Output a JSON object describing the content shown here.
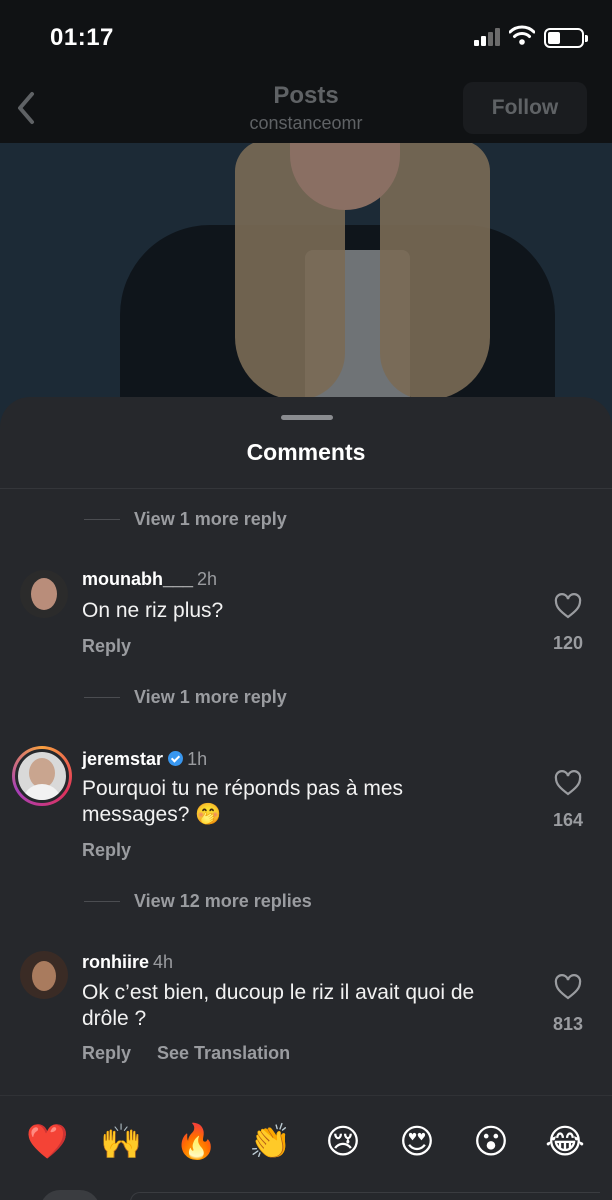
{
  "status_bar": {
    "time": "01:17"
  },
  "header": {
    "title": "Posts",
    "subtitle": "constanceomr",
    "follow_label": "Follow"
  },
  "sheet": {
    "title": "Comments"
  },
  "view_more": [
    {
      "label": "View 1 more reply"
    },
    {
      "label": "View 1 more reply"
    },
    {
      "label": "View 12 more replies"
    }
  ],
  "comments": [
    {
      "username": "mounabh___",
      "ago": "2h",
      "verified": false,
      "text": "On ne riz plus?",
      "likes": "120",
      "actions": [
        "Reply"
      ]
    },
    {
      "username": "jeremstar",
      "ago": "1h",
      "verified": true,
      "text": "Pourquoi tu ne réponds pas à mes messages? 🤭",
      "likes": "164",
      "actions": [
        "Reply"
      ]
    },
    {
      "username": "ronhiire",
      "ago": "4h",
      "verified": false,
      "text": "Ok c’est bien, ducoup le riz il avait quoi de drôle ?",
      "likes": "813",
      "actions": [
        "Reply",
        "See Translation"
      ]
    }
  ],
  "emoji_bar": [
    "❤️",
    "🙌",
    "🔥",
    "👏",
    "😢",
    "😍",
    "😮",
    "😂"
  ],
  "colors": {
    "sheet_bg": "#26282c",
    "muted_text": "#9a9ca0",
    "verified_blue": "#3897f0"
  }
}
